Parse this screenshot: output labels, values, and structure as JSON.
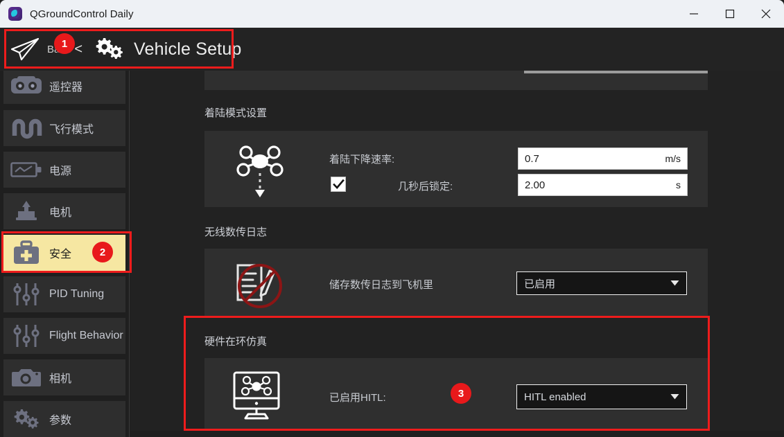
{
  "window": {
    "title": "QGroundControl Daily",
    "app_icon": "qgroundcontrol-logo-icon",
    "controls": {
      "minimize": "minimize-icon",
      "maximize": "maximize-icon",
      "close": "close-icon"
    }
  },
  "header": {
    "plane_icon": "paper-plane-icon",
    "back_label": "Back",
    "back_chevron": "<",
    "gear_icon": "gears-icon",
    "title": "Vehicle Setup"
  },
  "sidebar": {
    "items": [
      {
        "label": "遥控器",
        "icon": "radio-controller-icon",
        "selected": false
      },
      {
        "label": "飞行模式",
        "icon": "flight-modes-icon",
        "selected": false
      },
      {
        "label": "电源",
        "icon": "battery-power-icon",
        "selected": false
      },
      {
        "label": "电机",
        "icon": "motors-icon",
        "selected": false
      },
      {
        "label": "安全",
        "icon": "safety-kit-icon",
        "selected": true
      },
      {
        "label": "PID Tuning",
        "icon": "sliders-icon",
        "selected": false
      },
      {
        "label": "Flight Behavior",
        "icon": "sliders-icon",
        "selected": false
      },
      {
        "label": "相机",
        "icon": "camera-icon",
        "selected": false
      },
      {
        "label": "参数",
        "icon": "parameters-gears-icon",
        "selected": false
      }
    ]
  },
  "content": {
    "landing": {
      "section_title": "着陆模式设置",
      "icon": "quadcopter-descend-icon",
      "descent_rate_label": "着陆下降速率:",
      "descent_rate_value": "0.7",
      "descent_rate_unit": "m/s",
      "disarm_checkbox_checked": true,
      "disarm_label": "几秒后锁定:",
      "disarm_value": "2.00",
      "disarm_unit": "s"
    },
    "telemetry_log": {
      "section_title": "无线数传日志",
      "icon": "document-pencil-icon",
      "row_label": "储存数传日志到飞机里",
      "dropdown_value": "已启用",
      "dropdown_arrow": "chevron-down-icon"
    },
    "hitl": {
      "section_title": "硬件在环仿真",
      "icon": "monitor-quadcopter-icon",
      "row_label": "已启用HITL:",
      "dropdown_value": "HITL enabled",
      "dropdown_arrow": "chevron-down-icon"
    }
  },
  "annotations": {
    "badges": [
      {
        "number": "1",
        "target": "vehicle-setup-header"
      },
      {
        "number": "2",
        "target": "sidebar-item-safety"
      },
      {
        "number": "3",
        "target": "hitl-dropdown"
      }
    ],
    "boxes": [
      {
        "target": "vehicle-setup-header"
      },
      {
        "target": "sidebar-item-safety"
      },
      {
        "target": "hitl-section"
      }
    ],
    "slash": {
      "target": "telemetry-log-icon",
      "shape": "no-entry-circle-slash"
    },
    "box_color": "#ee1c1c",
    "badge_color": "#e8191b",
    "slash_color": "#8c1515"
  }
}
